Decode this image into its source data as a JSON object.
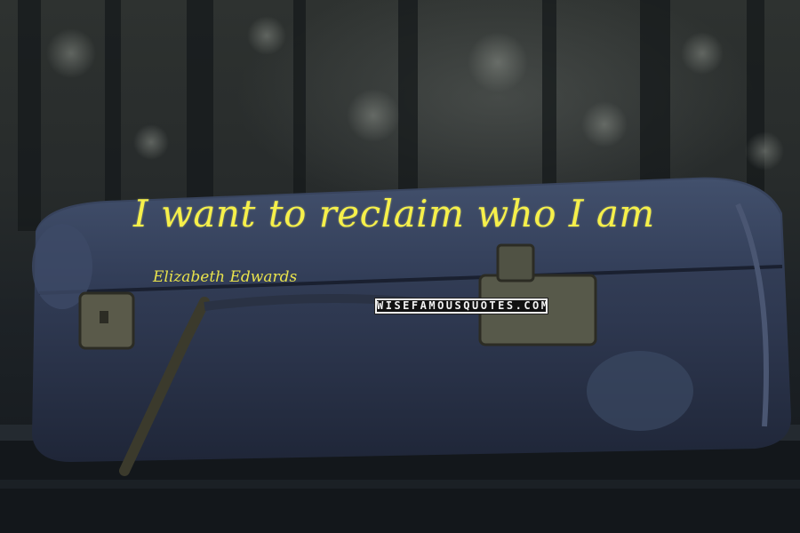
{
  "quote": {
    "text": "I want to reclaim who I am",
    "author": "Elizabeth Edwards"
  },
  "watermark": {
    "text": "WISEFAMOUSQUOTES.COM"
  },
  "colors": {
    "quote_text": "#f6f04a",
    "author_text": "#e8e24c",
    "suitcase": "#2f3a52",
    "background": "#1c2024"
  }
}
